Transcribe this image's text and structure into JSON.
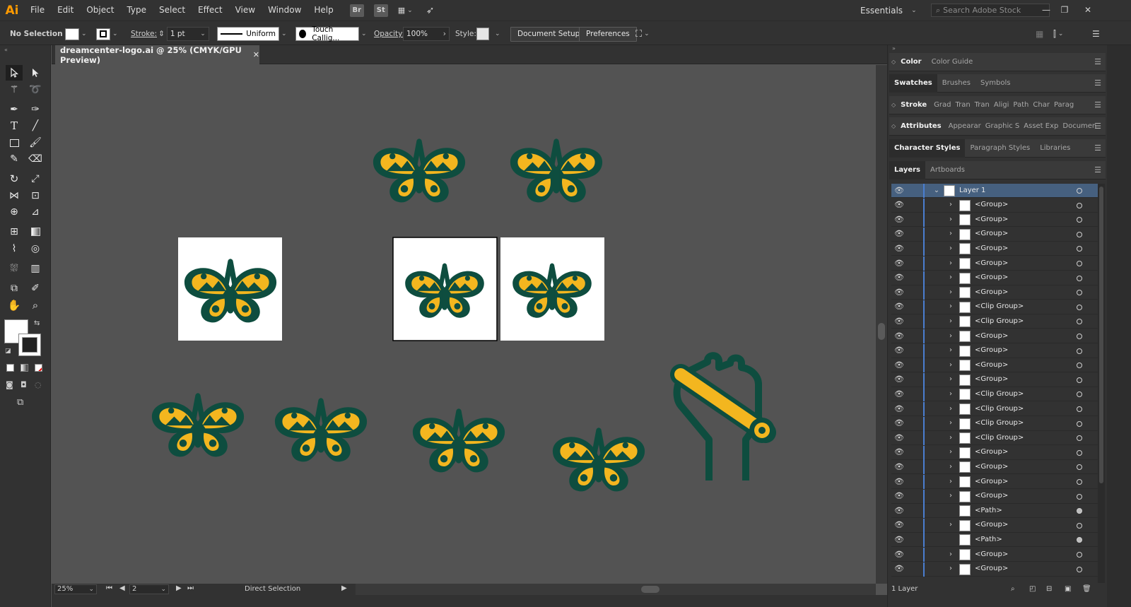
{
  "app": {
    "logo": "Ai"
  },
  "menu": [
    "File",
    "Edit",
    "Object",
    "Type",
    "Select",
    "Effect",
    "View",
    "Window",
    "Help"
  ],
  "bridge_buttons": [
    "Br",
    "St"
  ],
  "workspace": "Essentials",
  "search": {
    "placeholder": "Search Adobe Stock"
  },
  "control": {
    "selection": "No Selection",
    "stroke_label": "Stroke:",
    "stroke_weight": "1 pt",
    "profile": "Uniform",
    "brush": "Touch Callig...",
    "opacity_label": "Opacity:",
    "opacity": "100%",
    "style_label": "Style:",
    "doc_setup": "Document Setup",
    "preferences": "Preferences"
  },
  "document": {
    "tab_title": "dreamcenter-logo.ai @ 25% (CMYK/GPU Preview)",
    "zoom": "25%",
    "page": "2",
    "status": "Direct Selection"
  },
  "panels": {
    "row1": [
      "Color",
      "Color Guide"
    ],
    "row2": [
      "Swatches",
      "Brushes",
      "Symbols"
    ],
    "row3": [
      "Stroke",
      "Grad",
      "Tran",
      "Tran",
      "Aligi",
      "Path",
      "Char",
      "Parag"
    ],
    "row4": [
      "Attributes",
      "Appearar",
      "Graphic S",
      "Asset Exp",
      "Documen"
    ],
    "row5": [
      "Character Styles",
      "Paragraph Styles",
      "Libraries"
    ],
    "row6": [
      "Layers",
      "Artboards"
    ]
  },
  "layers": {
    "top": "Layer 1",
    "items": [
      "<Group>",
      "<Group>",
      "<Group>",
      "<Group>",
      "<Group>",
      "<Group>",
      "<Group>",
      "<Clip Group>",
      "<Clip Group>",
      "<Group>",
      "<Group>",
      "<Group>",
      "<Group>",
      "<Clip Group>",
      "<Clip Group>",
      "<Clip Group>",
      "<Clip Group>",
      "<Group>",
      "<Group>",
      "<Group>",
      "<Group>",
      "<Path>",
      "<Group>",
      "<Path>",
      "<Group>",
      "<Group>"
    ],
    "footer": "1 Layer"
  },
  "colors": {
    "green": "#0e4d3f",
    "yellow": "#f3b61f",
    "canvas": "#535353",
    "panel": "#323232"
  }
}
